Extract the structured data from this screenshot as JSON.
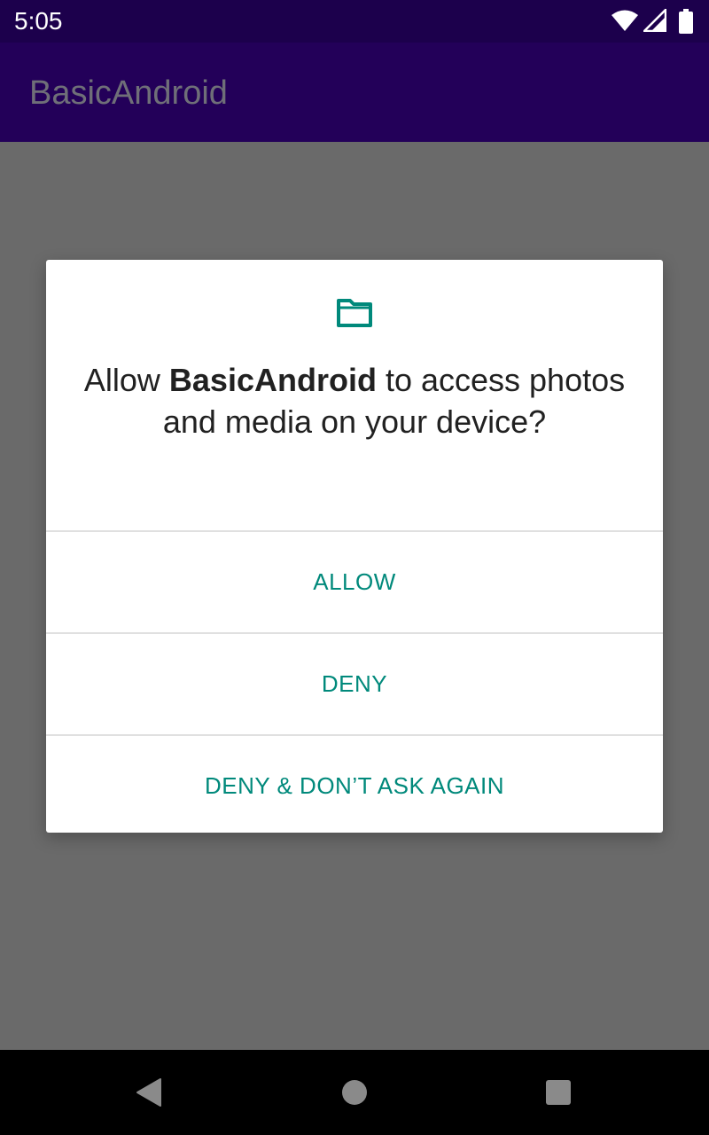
{
  "status_bar": {
    "time": "5:05",
    "icons": [
      "wifi-icon",
      "cell-signal-icon",
      "battery-icon"
    ]
  },
  "app_bar": {
    "title": "BasicAndroid"
  },
  "dialog": {
    "icon": "folder-icon",
    "message_prefix": "Allow ",
    "message_app": "BasicAndroid",
    "message_suffix": " to access photos and media on your device?",
    "buttons": [
      {
        "label": "ALLOW"
      },
      {
        "label": "DENY"
      },
      {
        "label": "DENY & DON’T ASK AGAIN"
      }
    ],
    "accent_color": "#00897b"
  },
  "nav_bar": {
    "icons": [
      "back-icon",
      "home-icon",
      "recents-icon"
    ]
  },
  "colors": {
    "status_bar": "#1c004c",
    "app_bar": "#230059",
    "scrim": "#6a6a6a"
  }
}
